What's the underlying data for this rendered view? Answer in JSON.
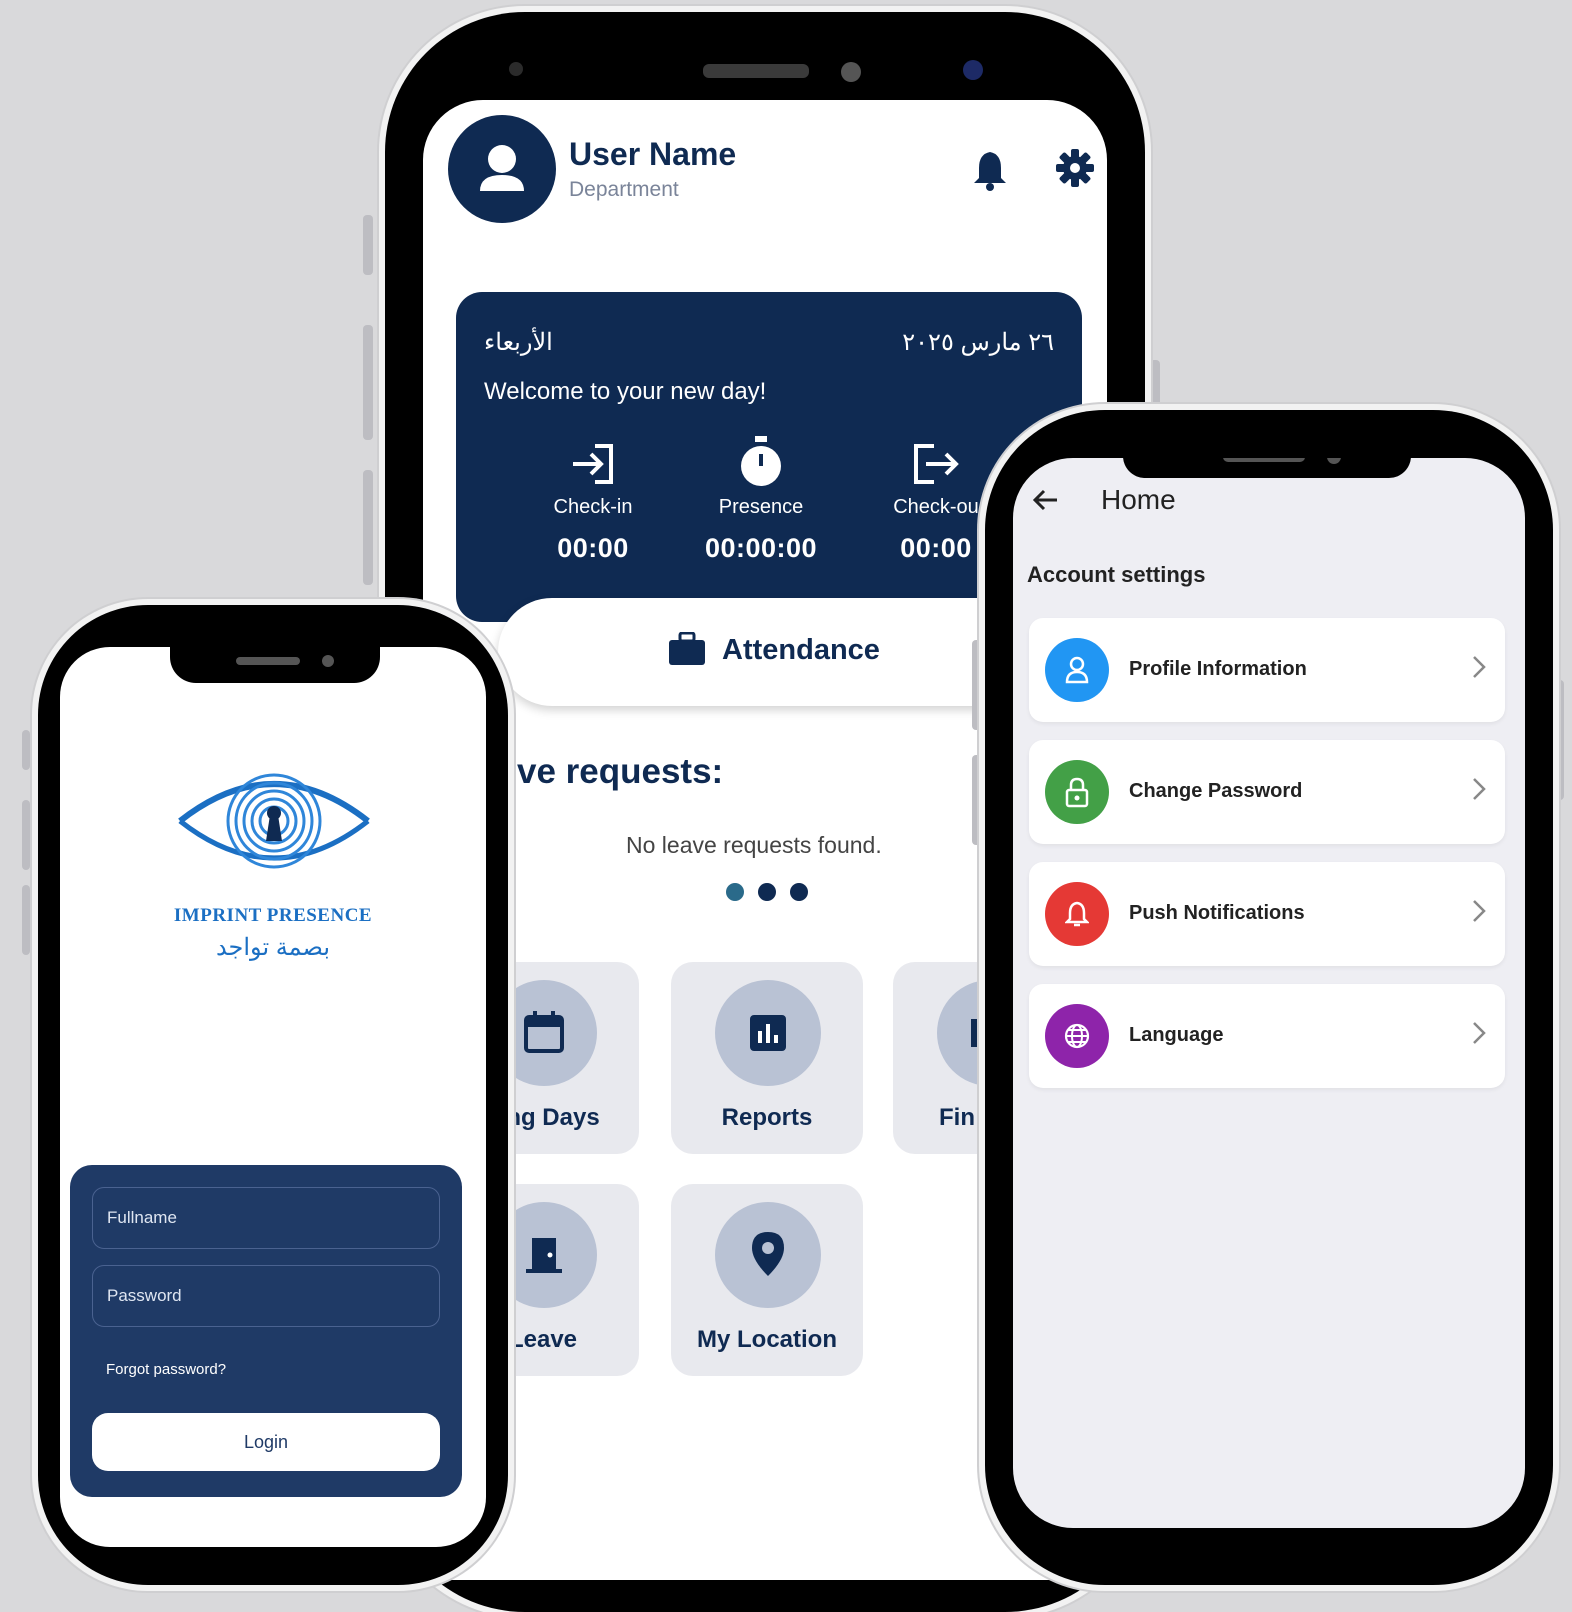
{
  "center_phone": {
    "header": {
      "user_name": "User Name",
      "department": "Department"
    },
    "day_card": {
      "weekday_ar": "الأربعاء",
      "date_ar": "٢٦ مارس ٢٠٢٥",
      "welcome": "Welcome to your new day!",
      "stats": [
        {
          "label": "Check-in",
          "value": "00:00",
          "icon": "login-icon"
        },
        {
          "label": "Presence",
          "value": "00:00:00",
          "icon": "stopwatch-icon"
        },
        {
          "label": "Check-ou",
          "value": "00:00",
          "icon": "logout-icon"
        }
      ]
    },
    "attendance_button": "Attendance",
    "leave_section_title": "ve requests:",
    "leave_empty_text": "No leave requests found.",
    "tiles": [
      {
        "label": "king Days",
        "icon": "calendar-icon"
      },
      {
        "label": "Reports",
        "icon": "chart-icon"
      },
      {
        "label": "Fin",
        "icon": "finance-icon"
      },
      {
        "label": "Leave",
        "icon": "door-icon"
      },
      {
        "label": "My Location",
        "icon": "location-pin-icon"
      }
    ]
  },
  "left_phone": {
    "brand_en": "IMPRINT PRESENCE",
    "brand_ar": "بصمة تواجد",
    "fullname_placeholder": "Fullname",
    "password_placeholder": "Password",
    "forgot_password": "Forgot password?",
    "login_button": "Login"
  },
  "right_phone": {
    "title": "Home",
    "section": "Account settings",
    "items": [
      {
        "label": "Profile Information",
        "color": "#2196f3",
        "icon": "person-icon"
      },
      {
        "label": "Change Password",
        "color": "#43a047",
        "icon": "lock-icon"
      },
      {
        "label": "Push Notifications",
        "color": "#e53935",
        "icon": "bell-icon"
      },
      {
        "label": "Language",
        "color": "#8e24aa",
        "icon": "globe-icon"
      }
    ]
  },
  "colors": {
    "navy": "#0f2a52",
    "login_panel": "#1f3a66",
    "background": "#d9d9db"
  }
}
